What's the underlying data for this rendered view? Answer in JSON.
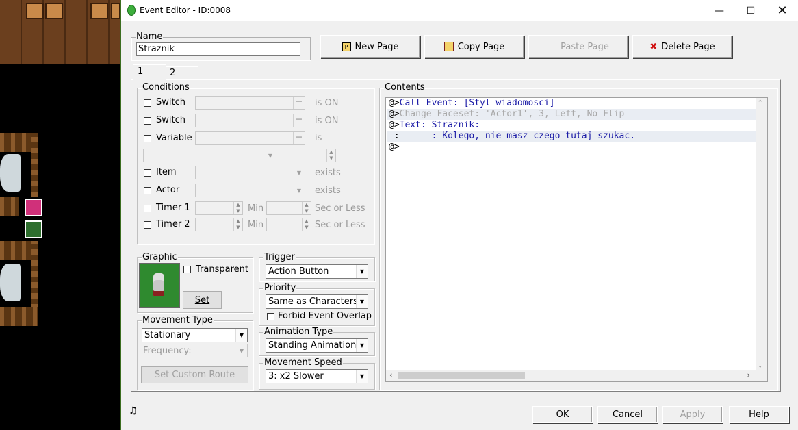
{
  "window": {
    "title": "Event Editor - ID:0008",
    "minimize_icon": "minimize-icon",
    "maximize_icon": "maximize-icon",
    "close_icon": "close-icon"
  },
  "name_section": {
    "label": "Name",
    "value": "Straznik"
  },
  "page_buttons": {
    "new_page": "New Page",
    "copy_page": "Copy Page",
    "paste_page": "Paste Page",
    "delete_page": "Delete Page"
  },
  "tabs": [
    {
      "label": "1"
    },
    {
      "label": "2"
    }
  ],
  "conditions": {
    "label": "Conditions",
    "switch1": {
      "label": "Switch",
      "suffix": "is ON"
    },
    "switch2": {
      "label": "Switch",
      "suffix": "is ON"
    },
    "variable": {
      "label": "Variable",
      "suffix": "is"
    },
    "item": {
      "label": "Item",
      "suffix": "exists"
    },
    "actor": {
      "label": "Actor",
      "suffix": "exists"
    },
    "timer1": {
      "label": "Timer 1",
      "min": "Min",
      "sec": "Sec or Less"
    },
    "timer2": {
      "label": "Timer 2",
      "min": "Min",
      "sec": "Sec or Less"
    }
  },
  "graphic": {
    "label": "Graphic",
    "transparent": "Transparent",
    "set": "Set"
  },
  "movement_type": {
    "label": "Movement Type",
    "value": "Stationary",
    "frequency": "Frequency:",
    "custom_route": "Set Custom Route"
  },
  "trigger": {
    "label": "Trigger",
    "value": "Action Button"
  },
  "priority": {
    "label": "Priority",
    "value": "Same as Characters",
    "forbid": "Forbid Event Overlap"
  },
  "animation_type": {
    "label": "Animation Type",
    "value": "Standing Animation"
  },
  "movement_speed": {
    "label": "Movement Speed",
    "value": "3: x2 Slower"
  },
  "contents": {
    "label": "Contents",
    "lines": [
      {
        "prefix": "@>",
        "text": "Call Event: [Styl wiadomosci]",
        "color": "#1a1aa6"
      },
      {
        "prefix": "@>",
        "text": "Change Faceset: 'Actor1', 3, Left, No Flip",
        "color": "#a8a8a8"
      },
      {
        "prefix": "@>",
        "text": "Text: Straznik:",
        "color": "#1a1aa6"
      },
      {
        "prefix": " :",
        "text": "      : Kolego, nie masz czego tutaj szukac.",
        "color": "#1a1aa6"
      },
      {
        "prefix": "@>",
        "text": "",
        "color": "#000000"
      }
    ]
  },
  "footer": {
    "ok": "OK",
    "cancel": "Cancel",
    "apply": "Apply",
    "help": "Help",
    "music_icon": "music-note-icon"
  }
}
